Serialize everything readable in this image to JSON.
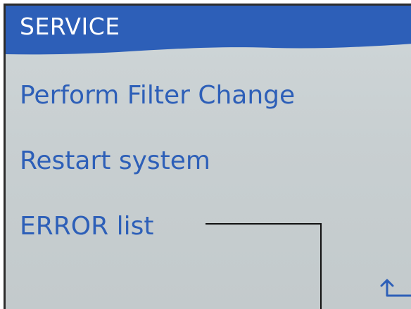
{
  "header": {
    "title": "SERVICE",
    "color": "#2d5fb8"
  },
  "menu": {
    "items": [
      {
        "label": "Perform Filter Change"
      },
      {
        "label": "Restart system"
      },
      {
        "label": "ERROR list"
      }
    ],
    "text_color": "#2d5fb8"
  },
  "navigation": {
    "back_icon": "return-arrow-icon"
  },
  "callout": {
    "icon": "leader-line"
  }
}
